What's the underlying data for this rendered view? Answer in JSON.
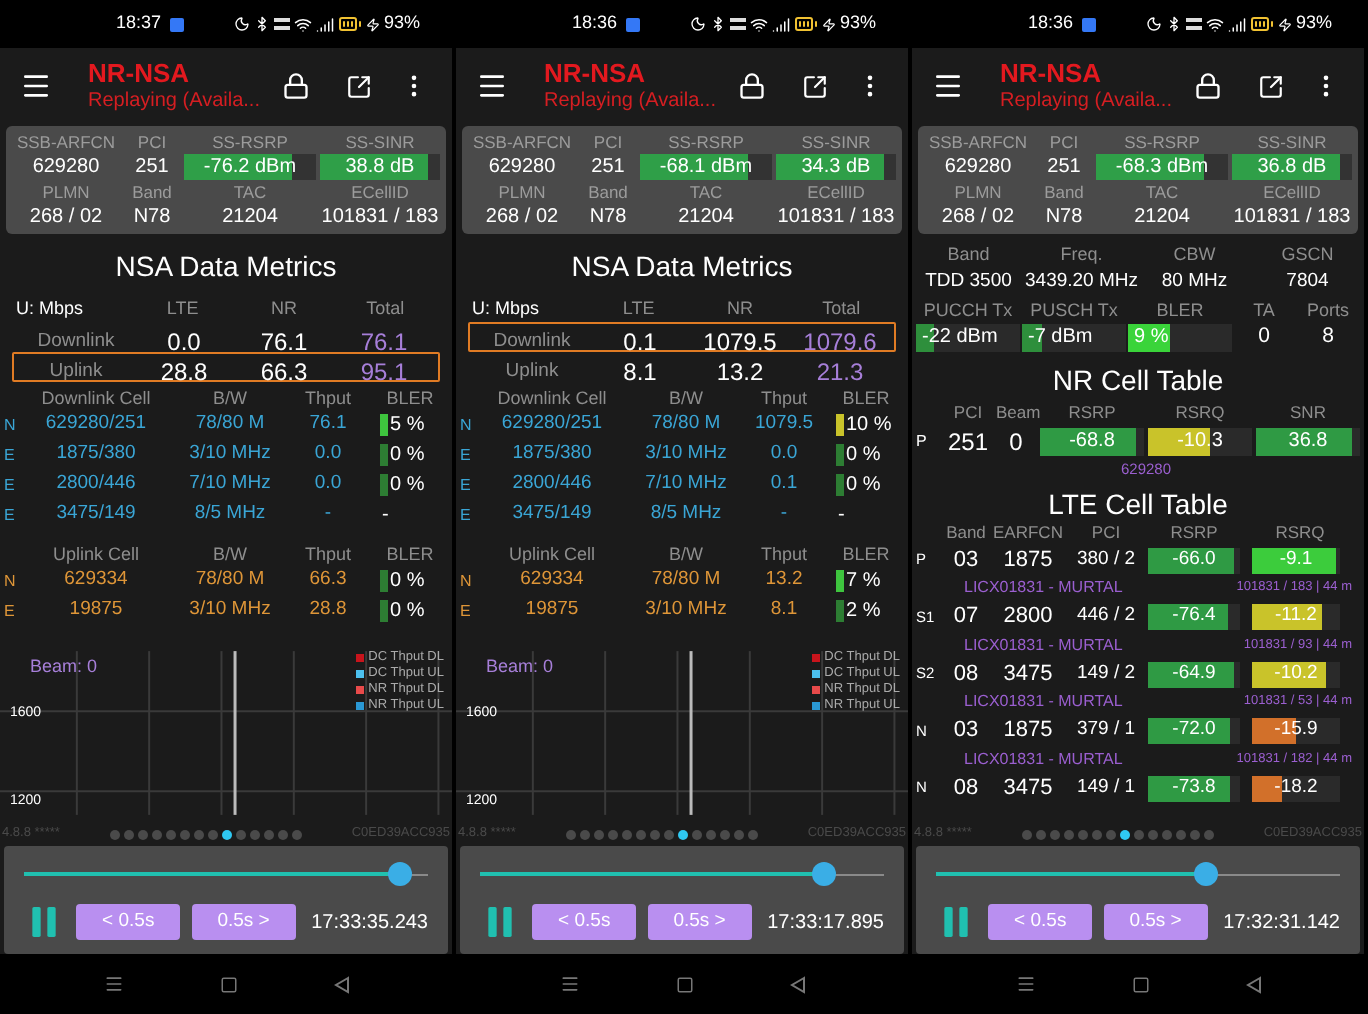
{
  "phones": [
    {
      "status_time": "18:37",
      "battery": "93%",
      "title": "NR-NSA",
      "subtitle": "Replaying (Availa...",
      "summary": [
        [
          {
            "label": "SSB-ARFCN",
            "kind": "text",
            "value": "629280"
          },
          {
            "label": "PCI",
            "kind": "text",
            "value": "251"
          },
          {
            "label": "SS-RSRP",
            "kind": "bar",
            "value": "-76.2 dBm",
            "level": 0.82,
            "color": "#2f9f48"
          },
          {
            "label": "SS-SINR",
            "kind": "bar",
            "value": "38.8 dB",
            "level": 0.9,
            "color": "#2f9f48"
          }
        ],
        [
          {
            "label": "PLMN",
            "kind": "text",
            "value": "268 / 02"
          },
          {
            "label": "Band",
            "kind": "text",
            "value": "N78"
          },
          {
            "label": "TAC",
            "kind": "text",
            "value": "21204"
          },
          {
            "label": "ECellID",
            "kind": "text",
            "value": "101831 / 183"
          }
        ]
      ],
      "content": {
        "kind": "nsa",
        "title": "NSA Data Metrics",
        "metrics": {
          "columns": [
            "U: Mbps",
            "LTE",
            "NR",
            "Total"
          ],
          "rows": [
            {
              "label": "Downlink",
              "lte": "0.0",
              "nr": "76.1",
              "total": "76.1",
              "highlighted": false
            },
            {
              "label": "Uplink",
              "lte": "28.8",
              "nr": "66.3",
              "total": "95.1",
              "highlighted": true
            }
          ]
        },
        "downlink": {
          "columns": [
            "Downlink Cell",
            "B/W",
            "Thput",
            "BLER"
          ],
          "rows": [
            {
              "type": "N",
              "cell": "629280/251",
              "bw": "78/80 M",
              "thput": "76.1",
              "bler": "5 %",
              "color": "#3ec43e"
            },
            {
              "type": "E",
              "cell": "1875/380",
              "bw": "3/10 MHz",
              "thput": "0.0",
              "bler": "0 %",
              "color": "#2d7d33"
            },
            {
              "type": "E",
              "cell": "2800/446",
              "bw": "7/10 MHz",
              "thput": "0.0",
              "bler": "0 %",
              "color": "#2d7d33"
            },
            {
              "type": "E",
              "cell": "3475/149",
              "bw": "8/5 MHz",
              "thput": "-",
              "bler": "-"
            }
          ]
        },
        "uplink": {
          "columns": [
            "Uplink Cell",
            "B/W",
            "Thput",
            "BLER"
          ],
          "rows": [
            {
              "type": "N",
              "cell": "629334",
              "bw": "78/80 M",
              "thput": "66.3",
              "bler": "0 %",
              "color": "#2d7d33"
            },
            {
              "type": "E",
              "cell": "19875",
              "bw": "3/10 MHz",
              "thput": "28.8",
              "bler": "0 %",
              "color": "#2d7d33"
            }
          ]
        },
        "chart": {
          "beam": "Beam: 0",
          "y_labels": [
            "1600",
            "1200"
          ],
          "legend": [
            {
              "name": "DC Thput DL",
              "color": "#c8141c"
            },
            {
              "name": "DC Thput UL",
              "color": "#4cc0ee"
            },
            {
              "name": "NR Thput DL",
              "color": "#e84a4a"
            },
            {
              "name": "NR Thput UL",
              "color": "#2a98d4"
            }
          ]
        }
      },
      "footer": {
        "version": "4.8.8 *****",
        "device": "C0ED39ACC935",
        "dots": [
          {
            "selected": false
          },
          {
            "selected": false
          },
          {
            "selected": false
          },
          {
            "selected": false
          },
          {
            "selected": false
          },
          {
            "selected": false
          },
          {
            "selected": false
          },
          {
            "selected": false
          },
          {
            "selected": true
          },
          {
            "selected": false
          },
          {
            "selected": false
          },
          {
            "selected": false
          },
          {
            "selected": false
          },
          {
            "selected": false
          }
        ]
      },
      "player": {
        "level": 0.93,
        "playing": true,
        "back": "< 0.5s",
        "forward": "0.5s >",
        "time": "17:33:35.243"
      }
    },
    {
      "status_time": "18:36",
      "battery": "93%",
      "title": "NR-NSA",
      "subtitle": "Replaying (Availa...",
      "summary": [
        [
          {
            "label": "SSB-ARFCN",
            "kind": "text",
            "value": "629280"
          },
          {
            "label": "PCI",
            "kind": "text",
            "value": "251"
          },
          {
            "label": "SS-RSRP",
            "kind": "bar",
            "value": "-68.1 dBm",
            "level": 0.82,
            "color": "#2f9f48"
          },
          {
            "label": "SS-SINR",
            "kind": "bar",
            "value": "34.3 dB",
            "level": 0.9,
            "color": "#2f9f48"
          }
        ],
        [
          {
            "label": "PLMN",
            "kind": "text",
            "value": "268 / 02"
          },
          {
            "label": "Band",
            "kind": "text",
            "value": "N78"
          },
          {
            "label": "TAC",
            "kind": "text",
            "value": "21204"
          },
          {
            "label": "ECellID",
            "kind": "text",
            "value": "101831 / 183"
          }
        ]
      ],
      "content": {
        "kind": "nsa",
        "title": "NSA Data Metrics",
        "metrics": {
          "columns": [
            "U: Mbps",
            "LTE",
            "NR",
            "Total"
          ],
          "rows": [
            {
              "label": "Downlink",
              "lte": "0.1",
              "nr": "1079.5",
              "total": "1079.6",
              "highlighted": true
            },
            {
              "label": "Uplink",
              "lte": "8.1",
              "nr": "13.2",
              "total": "21.3",
              "highlighted": false
            }
          ]
        },
        "downlink": {
          "columns": [
            "Downlink Cell",
            "B/W",
            "Thput",
            "BLER"
          ],
          "rows": [
            {
              "type": "N",
              "cell": "629280/251",
              "bw": "78/80 M",
              "thput": "1079.5",
              "bler": "10 %",
              "color": "#c9c32a"
            },
            {
              "type": "E",
              "cell": "1875/380",
              "bw": "3/10 MHz",
              "thput": "0.0",
              "bler": "0 %",
              "color": "#2d7d33"
            },
            {
              "type": "E",
              "cell": "2800/446",
              "bw": "7/10 MHz",
              "thput": "0.1",
              "bler": "0 %",
              "color": "#2d7d33"
            },
            {
              "type": "E",
              "cell": "3475/149",
              "bw": "8/5 MHz",
              "thput": "-",
              "bler": "-"
            }
          ]
        },
        "uplink": {
          "columns": [
            "Uplink Cell",
            "B/W",
            "Thput",
            "BLER"
          ],
          "rows": [
            {
              "type": "N",
              "cell": "629334",
              "bw": "78/80 M",
              "thput": "13.2",
              "bler": "7 %",
              "color": "#3ec43e"
            },
            {
              "type": "E",
              "cell": "19875",
              "bw": "3/10 MHz",
              "thput": "8.1",
              "bler": "2 %",
              "color": "#2d7d33"
            }
          ]
        },
        "chart": {
          "beam": "Beam: 0",
          "y_labels": [
            "1600",
            "1200"
          ],
          "legend": [
            {
              "name": "DC Thput DL",
              "color": "#c8141c"
            },
            {
              "name": "DC Thput UL",
              "color": "#4cc0ee"
            },
            {
              "name": "NR Thput DL",
              "color": "#e84a4a"
            },
            {
              "name": "NR Thput UL",
              "color": "#2a98d4"
            }
          ]
        }
      },
      "footer": {
        "version": "4.8.8 *****",
        "device": "C0ED39ACC935",
        "dots": [
          {
            "selected": false
          },
          {
            "selected": false
          },
          {
            "selected": false
          },
          {
            "selected": false
          },
          {
            "selected": false
          },
          {
            "selected": false
          },
          {
            "selected": false
          },
          {
            "selected": false
          },
          {
            "selected": true
          },
          {
            "selected": false
          },
          {
            "selected": false
          },
          {
            "selected": false
          },
          {
            "selected": false
          },
          {
            "selected": false
          }
        ]
      },
      "player": {
        "level": 0.85,
        "playing": true,
        "back": "< 0.5s",
        "forward": "0.5s >",
        "time": "17:33:17.895"
      }
    },
    {
      "status_time": "18:36",
      "battery": "93%",
      "title": "NR-NSA",
      "subtitle": "Replaying (Availa...",
      "summary": [
        [
          {
            "label": "SSB-ARFCN",
            "kind": "text",
            "value": "629280"
          },
          {
            "label": "PCI",
            "kind": "text",
            "value": "251"
          },
          {
            "label": "SS-RSRP",
            "kind": "bar",
            "value": "-68.3 dBm",
            "level": 0.82,
            "color": "#2f9f48"
          },
          {
            "label": "SS-SINR",
            "kind": "bar",
            "value": "36.8 dB",
            "level": 0.9,
            "color": "#2f9f48"
          }
        ],
        [
          {
            "label": "PLMN",
            "kind": "text",
            "value": "268 / 02"
          },
          {
            "label": "Band",
            "kind": "text",
            "value": "N78"
          },
          {
            "label": "TAC",
            "kind": "text",
            "value": "21204"
          },
          {
            "label": "ECellID",
            "kind": "text",
            "value": "101831 / 183"
          }
        ]
      ],
      "content": {
        "kind": "cells",
        "info": [
          {
            "label": "Band",
            "value": "TDD 3500"
          },
          {
            "label": "Freq.",
            "value": "3439.20 MHz"
          },
          {
            "label": "CBW",
            "value": "80 MHz"
          },
          {
            "label": "GSCN",
            "value": "7804"
          }
        ],
        "tx": [
          {
            "label": "PUCCH Tx",
            "kind": "bar",
            "value": "-22 dBm",
            "level": 0.18,
            "color": "#2e8f3c"
          },
          {
            "label": "PUSCH Tx",
            "kind": "bar",
            "value": "-7 dBm",
            "level": 0.2,
            "color": "#2e8f3c"
          },
          {
            "label": "BLER",
            "kind": "bar",
            "value": "9 %",
            "level": 0.4,
            "color": "#3ad43a"
          },
          {
            "label": "TA",
            "kind": "text",
            "value": "0"
          },
          {
            "label": "Ports",
            "kind": "text",
            "value": "8"
          }
        ],
        "nr_table": {
          "title": "NR Cell Table",
          "columns": [
            "PCI",
            "Beam",
            "RSRP",
            "RSRQ",
            "SNR"
          ],
          "rows": [
            {
              "type": "P",
              "pci": "251",
              "beam": "0",
              "rsrp": {
                "value": "-68.8",
                "level": 0.92,
                "color": "#2f9a44"
              },
              "rsrq": {
                "value": "-10.3",
                "level": 0.6,
                "color": "#c9c32a"
              },
              "snr": {
                "value": "36.8",
                "level": 0.92,
                "color": "#2f9a44"
              },
              "arfcn": "629280"
            }
          ]
        },
        "lte_table": {
          "title": "LTE Cell Table",
          "columns": [
            "Band",
            "EARFCN",
            "PCI",
            "RSRP",
            "RSRQ"
          ],
          "rows": [
            {
              "type": "P",
              "band": "03",
              "earfcn": "1875",
              "pci": "380 / 2",
              "rsrp": {
                "value": "-66.0",
                "level": 0.93,
                "color": "#2f9a44"
              },
              "rsrq": {
                "value": "-9.1",
                "level": 0.95,
                "color": "#3ccc3c"
              },
              "name": "LICX01831 - MURTAL",
              "info": "101831 / 183 | 44 m"
            },
            {
              "type": "S1",
              "band": "07",
              "earfcn": "2800",
              "pci": "446 / 2",
              "rsrp": {
                "value": "-76.4",
                "level": 0.86,
                "color": "#2f9a44"
              },
              "rsrq": {
                "value": "-11.2",
                "level": 0.8,
                "color": "#c9c32a"
              },
              "name": "LICX01831 - MURTAL",
              "info": "101831 / 93 | 44 m"
            },
            {
              "type": "S2",
              "band": "08",
              "earfcn": "3475",
              "pci": "149 / 2",
              "rsrp": {
                "value": "-64.9",
                "level": 0.94,
                "color": "#2f9a44"
              },
              "rsrq": {
                "value": "-10.2",
                "level": 0.85,
                "color": "#c9c32a"
              },
              "name": "LICX01831 - MURTAL",
              "info": "101831 / 53 | 44 m"
            },
            {
              "type": "N",
              "band": "03",
              "earfcn": "1875",
              "pci": "379 / 1",
              "rsrp": {
                "value": "-72.0",
                "level": 0.9,
                "color": "#2f9a44"
              },
              "rsrq": {
                "value": "-15.9",
                "level": 0.5,
                "color": "#d2702a"
              },
              "name": "LICX01831 - MURTAL",
              "info": "101831 / 182 | 44 m"
            },
            {
              "type": "N",
              "band": "08",
              "earfcn": "3475",
              "pci": "149 / 1",
              "rsrp": {
                "value": "-73.8",
                "level": 0.89,
                "color": "#2f9a44"
              },
              "rsrq": {
                "value": "-18.2",
                "level": 0.35,
                "color": "#d2702a"
              }
            }
          ]
        }
      },
      "footer": {
        "version": "4.8.8 *****",
        "device": "C0ED39ACC935",
        "dots": [
          {
            "selected": false
          },
          {
            "selected": false
          },
          {
            "selected": false
          },
          {
            "selected": false
          },
          {
            "selected": false
          },
          {
            "selected": false
          },
          {
            "selected": false
          },
          {
            "selected": true
          },
          {
            "selected": false
          },
          {
            "selected": false
          },
          {
            "selected": false
          },
          {
            "selected": false
          },
          {
            "selected": false
          },
          {
            "selected": false
          }
        ]
      },
      "player": {
        "level": 0.67,
        "playing": true,
        "back": "< 0.5s",
        "forward": "0.5s >",
        "time": "17:32:31.142"
      }
    }
  ]
}
